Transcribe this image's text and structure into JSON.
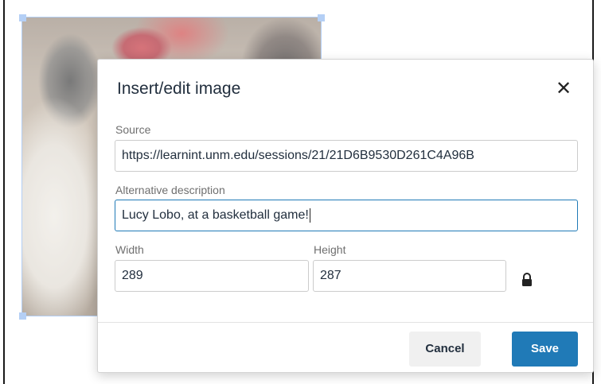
{
  "dialog": {
    "title": "Insert/edit image",
    "close_glyph": "✕",
    "source": {
      "label": "Source",
      "value": "https://learnint.unm.edu/sessions/21/21D6B9530D261C4A96B"
    },
    "alt": {
      "label": "Alternative description",
      "value": "Lucy Lobo, at a basketball game!"
    },
    "width": {
      "label": "Width",
      "value": "289"
    },
    "height": {
      "label": "Height",
      "value": "287"
    },
    "lock_icon": "lock-icon",
    "buttons": {
      "cancel": "Cancel",
      "save": "Save"
    }
  },
  "colors": {
    "primary": "#207ab7",
    "focus_border": "#207ab7",
    "selection_handle": "#b4cff5"
  }
}
